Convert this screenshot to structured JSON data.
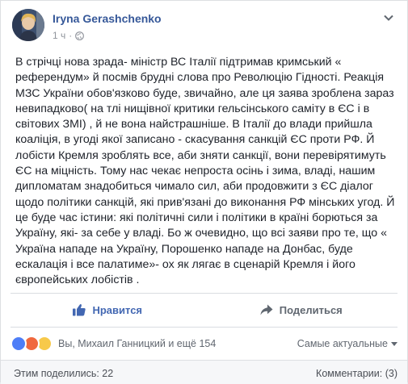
{
  "post": {
    "author": "Iryna Gerashchenko",
    "time": "1 ч",
    "separator": "·",
    "privacy_icon": "globe-icon",
    "text": "В стрічці нова зрада- міністр ВС Італії підтримав кримський « референдум» й посмів брудні слова про Революцію Гідності. Реакція МЗС України обов'язково буде, звичайно, але ця заява зроблена зараз невипадково( на тлі нищівної критики гельсінського саміту в ЄС і в світових ЗМІ) , й не вона найстрашніше. В Італії до влади прийшла коаліція, в угоді якої записано - скасування санкцій ЄС проти РФ. Й лобісти Кремля зроблять все, аби зняти санкції, вони перевірятимуть ЄС на міцність. Тому нас чекає непроста осінь і зима, владі, нашим дипломатам знадобиться чимало сил, аби продовжити з ЄС діалог щодо політики санкцій, які прив'язані до виконання РФ мінських угод. Й це буде час істини: які політичні сили і політики в країні борються за Україну, які- за себе у владі. Бо ж очевидно, що всі заяви про те, що « Україна нападе на Україну, Порошенко нападе на Донбас, буде ескалація і все палатиме»- ох як лягає в сценарій Кремля і його європейських лобістів ."
  },
  "actions": {
    "like_label": "Нравится",
    "share_label": "Поделиться"
  },
  "reactions": {
    "summary": "Вы, Михаил Ганницкий и ещё 154",
    "sort_label": "Самые актуальные"
  },
  "footer": {
    "shared": "Этим поделились: 22",
    "comments": "Комментарии: (3)"
  },
  "colors": {
    "link": "#365899",
    "liked": "#4267b2",
    "muted": "#90949c"
  }
}
